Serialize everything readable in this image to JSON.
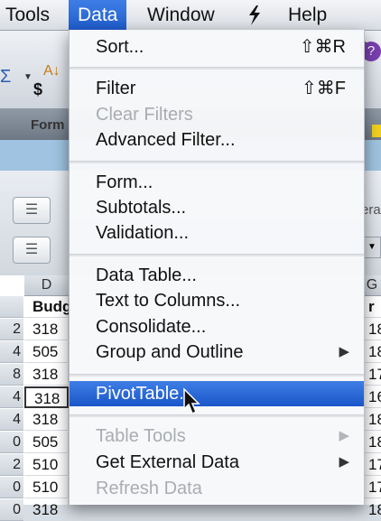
{
  "menubar": {
    "items": [
      "Tools",
      "Data",
      "Window",
      "Help"
    ],
    "script_icon": "script-menu-icon"
  },
  "background": {
    "dollar": "$",
    "form_tab": "Form",
    "right_text": "e.",
    "right_era": "era",
    "column_header": "D",
    "column_header_right": "G",
    "header_label": "Budg",
    "header_label_right": "r C",
    "rows": [
      {
        "num": "2",
        "value": "318",
        "right": "18"
      },
      {
        "num": "4",
        "value": "505",
        "right": "18"
      },
      {
        "num": "8",
        "value": "318",
        "right": "17"
      },
      {
        "num": "4",
        "value": "318",
        "right": "16"
      },
      {
        "num": "4",
        "value": "318",
        "right": "18"
      },
      {
        "num": "0",
        "value": "505",
        "right": "18"
      },
      {
        "num": "2",
        "value": "510",
        "right": "17"
      },
      {
        "num": "0",
        "value": "510",
        "right": "17"
      },
      {
        "num": "0",
        "value": "318",
        "right": "18"
      }
    ]
  },
  "menu": {
    "sort": {
      "label": "Sort...",
      "shortcut": "⇧⌘R"
    },
    "filter": {
      "label": "Filter",
      "shortcut": "⇧⌘F"
    },
    "clear_filters": "Clear Filters",
    "advanced_filter": "Advanced Filter...",
    "form": "Form...",
    "subtotals": "Subtotals...",
    "validation": "Validation...",
    "data_table": "Data Table...",
    "text_to_columns": "Text to Columns...",
    "consolidate": "Consolidate...",
    "group_and_outline": "Group and Outline",
    "pivot_table": "PivotTable...",
    "table_tools": "Table Tools",
    "get_external_data": "Get External Data",
    "refresh_data": "Refresh Data"
  },
  "colors": {
    "highlight": "#2a66d6",
    "disabled_text": "#a9acb1"
  }
}
